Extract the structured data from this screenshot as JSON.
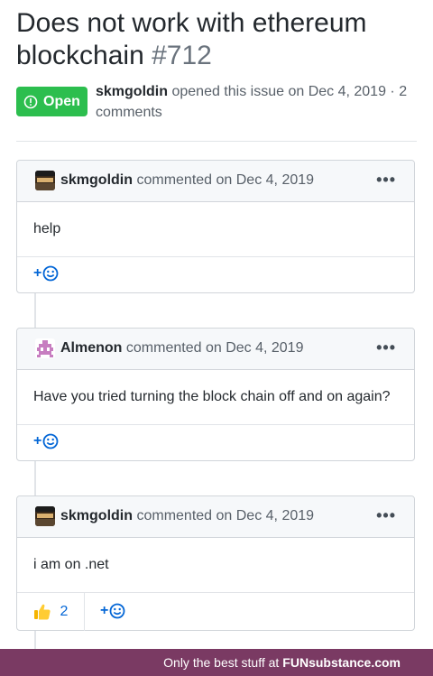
{
  "issue": {
    "title": "Does not work with ethereum blockchain",
    "number": "#712",
    "status": "Open",
    "author": "skmgoldin",
    "meta_rest": "opened this issue on Dec 4, 2019 · 2 comments"
  },
  "comments": [
    {
      "author": "skmgoldin",
      "action": "commented on Dec 4, 2019",
      "body": "help",
      "menu": "•••",
      "reaction_add": "+"
    },
    {
      "author": "Almenon",
      "action": "commented on Dec 4, 2019",
      "body": "Have you tried turning the block chain off and on again?",
      "menu": "•••",
      "reaction_add": "+"
    },
    {
      "author": "skmgoldin",
      "action": "commented on Dec 4, 2019",
      "body": "i am on .net",
      "menu": "•••",
      "reaction_add": "+",
      "thumbs_count": "2"
    }
  ],
  "banner": {
    "text": "Only the best stuff at",
    "brand": "FUNsubstance.com"
  },
  "colors": {
    "open_green": "#2cbe4e",
    "link_blue": "#0366d6",
    "banner_bg": "#7a3a63"
  }
}
